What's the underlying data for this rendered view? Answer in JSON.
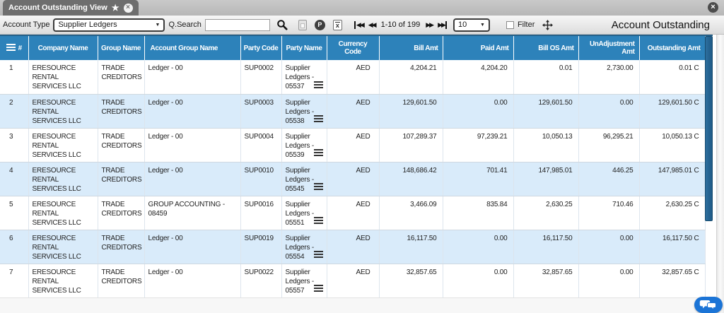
{
  "colors": {
    "header_blue": "#2d82ba",
    "row_alt_blue": "#d9ebfa",
    "scrollbar_thumb_blue": "#1f5a86",
    "chat_fab_blue": "#1b74d6",
    "tab_gray": "#6e6e6e"
  },
  "tab_bar": {
    "tab_title": "Account Outstanding View",
    "star_icon": "★",
    "tab_close_glyph": "×",
    "window_close_glyph": "×"
  },
  "toolbar": {
    "account_type_label": "Account Type",
    "account_type_value": "Supplier Ledgers",
    "search_label": "Q.Search",
    "search_value": "",
    "pdf_icon_letter": "P",
    "excel_icon_letter": "x",
    "pager_first_glyph": "◀◀",
    "pager_prev_glyph": "◀◀",
    "pagination_range": "1-10 of 199",
    "pager_next_glyph": "▶▶",
    "pager_last_glyph": "▶▶",
    "page_size": "10",
    "filter_label": "Filter",
    "view_title": "Account Outstanding"
  },
  "table": {
    "headers": [
      "#",
      "Company Name",
      "Group Name",
      "Account Group Name",
      "Party Code",
      "Party Name",
      "Currency Code",
      "Bill Amt",
      "Paid Amt",
      "Bill OS Amt",
      "UnAdjustment Amt",
      "Outstanding Amt"
    ],
    "rows": [
      {
        "num": "1",
        "company": "ERESOURCE RENTAL SERVICES LLC",
        "group": "TRADE CREDITORS",
        "account_group": "Ledger - 00",
        "party_code": "SUP0002",
        "party_name": "Supplier Ledgers - 05537",
        "currency": "AED",
        "bill_amt": "4,204.21",
        "paid_amt": "4,204.20",
        "bill_os_amt": "0.01",
        "unadjustment_amt": "2,730.00",
        "outstanding_amt": "0.01 C"
      },
      {
        "num": "2",
        "company": "ERESOURCE RENTAL SERVICES LLC",
        "group": "TRADE CREDITORS",
        "account_group": "Ledger - 00",
        "party_code": "SUP0003",
        "party_name": "Supplier Ledgers - 05538",
        "currency": "AED",
        "bill_amt": "129,601.50",
        "paid_amt": "0.00",
        "bill_os_amt": "129,601.50",
        "unadjustment_amt": "0.00",
        "outstanding_amt": "129,601.50 C"
      },
      {
        "num": "3",
        "company": "ERESOURCE RENTAL SERVICES LLC",
        "group": "TRADE CREDITORS",
        "account_group": "Ledger - 00",
        "party_code": "SUP0004",
        "party_name": "Supplier Ledgers - 05539",
        "currency": "AED",
        "bill_amt": "107,289.37",
        "paid_amt": "97,239.21",
        "bill_os_amt": "10,050.13",
        "unadjustment_amt": "96,295.21",
        "outstanding_amt": "10,050.13 C"
      },
      {
        "num": "4",
        "company": "ERESOURCE RENTAL SERVICES LLC",
        "group": "TRADE CREDITORS",
        "account_group": "Ledger - 00",
        "party_code": "SUP0010",
        "party_name": "Supplier Ledgers - 05545",
        "currency": "AED",
        "bill_amt": "148,686.42",
        "paid_amt": "701.41",
        "bill_os_amt": "147,985.01",
        "unadjustment_amt": "446.25",
        "outstanding_amt": "147,985.01 C"
      },
      {
        "num": "5",
        "company": "ERESOURCE RENTAL SERVICES LLC",
        "group": "TRADE CREDITORS",
        "account_group": "GROUP ACCOUNTING - 08459",
        "party_code": "SUP0016",
        "party_name": "Supplier Ledgers - 05551",
        "currency": "AED",
        "bill_amt": "3,466.09",
        "paid_amt": "835.84",
        "bill_os_amt": "2,630.25",
        "unadjustment_amt": "710.46",
        "outstanding_amt": "2,630.25 C"
      },
      {
        "num": "6",
        "company": "ERESOURCE RENTAL SERVICES LLC",
        "group": "TRADE CREDITORS",
        "account_group": "Ledger - 00",
        "party_code": "SUP0019",
        "party_name": "Supplier Ledgers - 05554",
        "currency": "AED",
        "bill_amt": "16,117.50",
        "paid_amt": "0.00",
        "bill_os_amt": "16,117.50",
        "unadjustment_amt": "0.00",
        "outstanding_amt": "16,117.50 C"
      },
      {
        "num": "7",
        "company": "ERESOURCE RENTAL SERVICES LLC",
        "group": "TRADE CREDITORS",
        "account_group": "Ledger - 00",
        "party_code": "SUP0022",
        "party_name": "Supplier Ledgers - 05557",
        "currency": "AED",
        "bill_amt": "32,857.65",
        "paid_amt": "0.00",
        "bill_os_amt": "32,857.65",
        "unadjustment_amt": "0.00",
        "outstanding_amt": "32,857.65 C"
      }
    ]
  }
}
